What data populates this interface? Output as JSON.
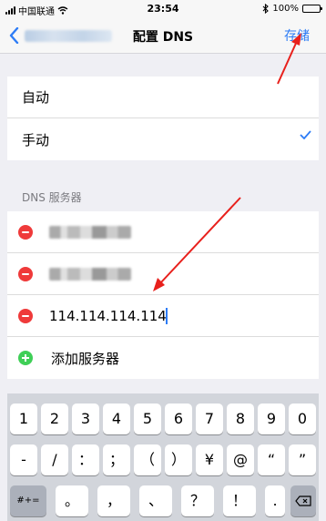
{
  "status_bar": {
    "carrier": "中国联通",
    "time": "23:54",
    "battery": "100%"
  },
  "nav": {
    "back_label": "",
    "title": "配置 DNS",
    "save_label": "存储"
  },
  "mode_options": [
    {
      "label": "自动",
      "selected": false
    },
    {
      "label": "手动",
      "selected": true
    }
  ],
  "servers_section": {
    "header": "DNS 服务器",
    "new_server_value": "114.114.114.114",
    "add_label": "添加服务器"
  },
  "keyboard": {
    "row1": [
      "1",
      "2",
      "3",
      "4",
      "5",
      "6",
      "7",
      "8",
      "9",
      "0"
    ],
    "row2": [
      "-",
      "/",
      "：",
      "；",
      "（",
      "）",
      "¥",
      "@",
      "“",
      "”"
    ],
    "row3": [
      "#+=",
      "。",
      "，",
      "、",
      "？",
      "！",
      "."
    ]
  },
  "colors": {
    "accent": "#2d7cf6",
    "delete": "#ef3a3a",
    "add": "#3fcf57",
    "annotation": "#e8201c"
  }
}
